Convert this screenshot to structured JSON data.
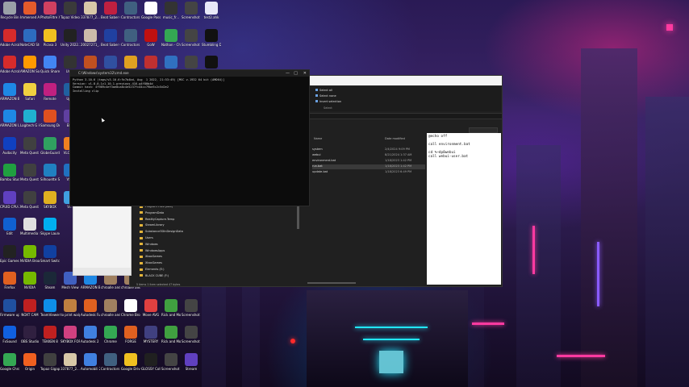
{
  "colors": {
    "accent_blue": "#0a74da",
    "folder": "#e3b43a",
    "console_bg": "#0c0c0c"
  },
  "desktop_icons": [
    {
      "label": "Recycle Bin",
      "color": "#9aa0a8",
      "icon": "recycle-bin-icon",
      "col": 0,
      "row": 0
    },
    {
      "label": "Immersed Agent",
      "color": "#e55a2b",
      "icon": "app-icon",
      "col": 1,
      "row": 0
    },
    {
      "label": "PhotoFiltre X",
      "color": "#d04060",
      "icon": "app-icon",
      "col": 2,
      "row": 0
    },
    {
      "label": "Topaz Video AI",
      "color": "#3a3a3a",
      "icon": "app-icon",
      "col": 3,
      "row": 0
    },
    {
      "label": "337877_2...",
      "color": "#d8c8a8",
      "icon": "file-icon",
      "col": 4,
      "row": 0
    },
    {
      "label": "Beat Saber (SteamVR)",
      "color": "#c02040",
      "icon": "app-icon",
      "col": 5,
      "row": 0
    },
    {
      "label": "Contractors Showdow...",
      "color": "#406080",
      "icon": "app-icon",
      "col": 6,
      "row": 0
    },
    {
      "label": "Google Passes...",
      "color": "#ffffff",
      "icon": "file-icon",
      "col": 7,
      "row": 0
    },
    {
      "label": "music_fr...",
      "color": "#333333",
      "icon": "file-icon",
      "col": 8,
      "row": 0
    },
    {
      "label": "Screenshot 2023-11-2...",
      "color": "#444444",
      "icon": "image-icon",
      "col": 9,
      "row": 0
    },
    {
      "label": "test2.ahk",
      "color": "#e8e8f8",
      "icon": "script-icon",
      "col": 10,
      "row": 0
    },
    {
      "label": "Adobe Acrobat",
      "color": "#d62b2b",
      "icon": "app-icon",
      "col": 0,
      "row": 1
    },
    {
      "label": "NoteCAD Studio 2024",
      "color": "#2d6cc0",
      "icon": "app-icon",
      "col": 1,
      "row": 1
    },
    {
      "label": "Picasa 3",
      "color": "#f0c020",
      "icon": "app-icon",
      "col": 2,
      "row": 1
    },
    {
      "label": "Unity 2022.3.16f1",
      "color": "#222222",
      "icon": "app-icon",
      "col": 3,
      "row": 1
    },
    {
      "label": "20027271_...",
      "color": "#ccbbaa",
      "icon": "file-icon",
      "col": 4,
      "row": 1
    },
    {
      "label": "Beat Saber (VD)",
      "color": "#2040a0",
      "icon": "app-icon",
      "col": 5,
      "row": 1
    },
    {
      "label": "Contractors Showdow...",
      "color": "#406080",
      "icon": "app-icon",
      "col": 6,
      "row": 1
    },
    {
      "label": "GoW",
      "color": "#c01010",
      "icon": "app-icon",
      "col": 7,
      "row": 1
    },
    {
      "label": "Nathan - Chrome",
      "color": "#34a853",
      "icon": "chrome-icon",
      "col": 8,
      "row": 1
    },
    {
      "label": "Screenshot 2023-11-0...",
      "color": "#444444",
      "icon": "image-icon",
      "col": 9,
      "row": 1
    },
    {
      "label": "Stumbling Death - Sam...",
      "color": "#111111",
      "icon": "app-icon",
      "col": 10,
      "row": 1
    },
    {
      "label": "Adobe Acrobat...",
      "color": "#d62b2b",
      "icon": "app-icon",
      "col": 0,
      "row": 2
    },
    {
      "label": "AMAZON Software...",
      "color": "#ff9900",
      "icon": "app-icon",
      "col": 1,
      "row": 2
    },
    {
      "label": "Quick Share from Google",
      "color": "#4285f4",
      "icon": "app-icon",
      "col": 2,
      "row": 2
    },
    {
      "label": "Unity",
      "color": "#333333",
      "icon": "app-icon",
      "col": 3,
      "row": 2
    },
    {
      "label": "",
      "color": "#c05020",
      "icon": "app-icon",
      "col": 4,
      "row": 2
    },
    {
      "label": "",
      "color": "#3050a0",
      "icon": "app-icon",
      "col": 5,
      "row": 2
    },
    {
      "label": "",
      "color": "#e0a020",
      "icon": "app-icon",
      "col": 6,
      "row": 2
    },
    {
      "label": "",
      "color": "#c03030",
      "icon": "app-icon",
      "col": 7,
      "row": 2
    },
    {
      "label": "",
      "color": "#3070c0",
      "icon": "app-icon",
      "col": 8,
      "row": 2
    },
    {
      "label": "",
      "color": "#444444",
      "icon": "image-icon",
      "col": 9,
      "row": 2
    },
    {
      "label": "",
      "color": "#111111",
      "icon": "app-icon",
      "col": 10,
      "row": 2
    },
    {
      "label": "ARMAZON Browser",
      "color": "#1e88e5",
      "icon": "app-icon",
      "col": 0,
      "row": 3
    },
    {
      "label": "Safari",
      "color": "#f0d040",
      "icon": "app-icon",
      "col": 1,
      "row": 3
    },
    {
      "label": "Remote",
      "color": "#c02080",
      "icon": "app-icon",
      "col": 2,
      "row": 3
    },
    {
      "label": "Up...",
      "color": "#2060a0",
      "icon": "app-icon",
      "col": 3,
      "row": 3
    },
    {
      "label": "ARMAZON Updater",
      "color": "#1e88e5",
      "icon": "app-icon",
      "col": 0,
      "row": 4
    },
    {
      "label": "Logitech G HUB",
      "color": "#20b0d0",
      "icon": "app-icon",
      "col": 1,
      "row": 4
    },
    {
      "label": "Samsung DeX",
      "color": "#e05020",
      "icon": "app-icon",
      "col": 2,
      "row": 4
    },
    {
      "label": "Eli...",
      "color": "#6040a0",
      "icon": "app-icon",
      "col": 3,
      "row": 4
    },
    {
      "label": "Audacity",
      "color": "#1040c0",
      "icon": "app-icon",
      "col": 0,
      "row": 5
    },
    {
      "label": "Meta Quest Developer",
      "color": "#404040",
      "icon": "app-icon",
      "col": 1,
      "row": 5
    },
    {
      "label": "GlobeGuard",
      "color": "#30a060",
      "icon": "app-icon",
      "col": 2,
      "row": 5
    },
    {
      "label": "VLC m...",
      "color": "#f08020",
      "icon": "app-icon",
      "col": 3,
      "row": 5
    },
    {
      "label": "Bambu Studio",
      "color": "#20a040",
      "icon": "app-icon",
      "col": 0,
      "row": 6
    },
    {
      "label": "Meta Quest Link",
      "color": "#404040",
      "icon": "app-icon",
      "col": 1,
      "row": 6
    },
    {
      "label": "Silhouette Studio",
      "color": "#2080c0",
      "icon": "app-icon",
      "col": 2,
      "row": 6
    },
    {
      "label": "VS...",
      "color": "#2070c0",
      "icon": "app-icon",
      "col": 3,
      "row": 6
    },
    {
      "label": "CPUID CPU-Z",
      "color": "#6040c0",
      "icon": "app-icon",
      "col": 0,
      "row": 7
    },
    {
      "label": "Meta Quest Remote D...",
      "color": "#404040",
      "icon": "app-icon",
      "col": 1,
      "row": 7
    },
    {
      "label": "SKYBOX",
      "color": "#e0b020",
      "icon": "app-icon",
      "col": 2,
      "row": 7
    },
    {
      "label": "Vi...",
      "color": "#40a0e0",
      "icon": "app-icon",
      "col": 3,
      "row": 7
    },
    {
      "label": "Edit",
      "color": "#1060d0",
      "icon": "app-icon",
      "col": 0,
      "row": 8
    },
    {
      "label": "Multimedia Product Tool",
      "color": "#e0e0e0",
      "icon": "app-icon",
      "col": 1,
      "row": 8
    },
    {
      "label": "Skype Launcher",
      "color": "#00aff0",
      "icon": "app-icon",
      "col": 2,
      "row": 8
    },
    {
      "label": "Epic Games Launcher",
      "color": "#222222",
      "icon": "app-icon",
      "col": 0,
      "row": 9
    },
    {
      "label": "NVIDIA Broadcast",
      "color": "#76b900",
      "icon": "app-icon",
      "col": 1,
      "row": 9
    },
    {
      "label": "Smart Switch",
      "color": "#1040a0",
      "icon": "app-icon",
      "col": 2,
      "row": 9
    },
    {
      "label": "Firefox",
      "color": "#e06020",
      "icon": "app-icon",
      "col": 0,
      "row": 10
    },
    {
      "label": "NVIDIA",
      "color": "#76b900",
      "icon": "app-icon",
      "col": 1,
      "row": 10
    },
    {
      "label": "Steam",
      "color": "#1b2838",
      "icon": "app-icon",
      "col": 2,
      "row": 10
    },
    {
      "label": "Mesh View",
      "color": "#4060c0",
      "icon": "app-icon",
      "col": 3,
      "row": 10
    },
    {
      "label": "ARMAZON Browser",
      "color": "#1e88e5",
      "icon": "app-icon",
      "col": 4,
      "row": 10
    },
    {
      "label": "chroalle and balls.jpg",
      "color": "#a08060",
      "icon": "image-icon",
      "col": 5,
      "row": 10
    },
    {
      "label": "chroalle and balls",
      "color": "#a08060",
      "icon": "image-icon",
      "col": 6,
      "row": 10
    },
    {
      "label": "Firmware update fo...",
      "color": "#2050a0",
      "icon": "app-icon",
      "col": 0,
      "row": 11
    },
    {
      "label": "NOXT CAM",
      "color": "#c02020",
      "icon": "app-icon",
      "col": 1,
      "row": 11
    },
    {
      "label": "TeamViewer",
      "color": "#0e8ee9",
      "icon": "app-icon",
      "col": 2,
      "row": 11
    },
    {
      "label": "to print walgreens",
      "color": "#c08040",
      "icon": "file-icon",
      "col": 3,
      "row": 11
    },
    {
      "label": "Autodesk Fusion 360",
      "color": "#e06020",
      "icon": "app-icon",
      "col": 4,
      "row": 11
    },
    {
      "label": "chroalle and balls-glogg...",
      "color": "#a08060",
      "icon": "image-icon",
      "col": 5,
      "row": 11
    },
    {
      "label": "Chrome Browse MOCKUP",
      "color": "#ffffff",
      "icon": "chrome-icon",
      "col": 6,
      "row": 11
    },
    {
      "label": "Move AVG",
      "color": "#e04040",
      "icon": "app-icon",
      "col": 7,
      "row": 11
    },
    {
      "label": "Rick and Morty",
      "color": "#40a040",
      "icon": "app-icon",
      "col": 8,
      "row": 11
    },
    {
      "label": "Screenshot 2023-11...",
      "color": "#444444",
      "icon": "image-icon",
      "col": 9,
      "row": 11
    },
    {
      "label": "FxSound",
      "color": "#1060e0",
      "icon": "app-icon",
      "col": 0,
      "row": 12
    },
    {
      "label": "OBS Studio",
      "color": "#302040",
      "icon": "app-icon",
      "col": 1,
      "row": 12
    },
    {
      "label": "TEKKEN 8",
      "color": "#c02020",
      "icon": "app-icon",
      "col": 2,
      "row": 12
    },
    {
      "label": "SKYBOX FOR...",
      "color": "#d04080",
      "icon": "app-icon",
      "col": 3,
      "row": 12
    },
    {
      "label": "Autodesk 2 (SteamVR)",
      "color": "#4080e0",
      "icon": "app-icon",
      "col": 4,
      "row": 12
    },
    {
      "label": "Chrome",
      "color": "#34a853",
      "icon": "chrome-icon",
      "col": 5,
      "row": 12
    },
    {
      "label": "FORGE",
      "color": "#e06020",
      "icon": "app-icon",
      "col": 6,
      "row": 12
    },
    {
      "label": "MYSTERY",
      "color": "#404080",
      "icon": "app-icon",
      "col": 7,
      "row": 12
    },
    {
      "label": "Rick and Morty",
      "color": "#40a040",
      "icon": "app-icon",
      "col": 8,
      "row": 12
    },
    {
      "label": "Screenshot 2023-11-0...",
      "color": "#444444",
      "icon": "image-icon",
      "col": 9,
      "row": 12
    },
    {
      "label": "Google Chrome",
      "color": "#34a853",
      "icon": "chrome-icon",
      "col": 0,
      "row": 13
    },
    {
      "label": "Origin",
      "color": "#f06020",
      "icon": "app-icon",
      "col": 1,
      "row": 13
    },
    {
      "label": "Topaz Gigapixel AI",
      "color": "#404040",
      "icon": "app-icon",
      "col": 2,
      "row": 13
    },
    {
      "label": "337877_2...",
      "color": "#d8c8a8",
      "icon": "file-icon",
      "col": 3,
      "row": 13
    },
    {
      "label": "Automobili 2 (VD)",
      "color": "#4080e0",
      "icon": "app-icon",
      "col": 4,
      "row": 13
    },
    {
      "label": "Contractors Showdow...",
      "color": "#406080",
      "icon": "app-icon",
      "col": 5,
      "row": 13
    },
    {
      "label": "Google Drive",
      "color": "#f0c020",
      "icon": "app-icon",
      "col": 6,
      "row": 13
    },
    {
      "label": "GLOSSY Collection...",
      "color": "#202020",
      "icon": "app-icon",
      "col": 7,
      "row": 13
    },
    {
      "label": "Screenshot 2023-11-0...",
      "color": "#444444",
      "icon": "image-icon",
      "col": 8,
      "row": 13
    },
    {
      "label": "Stream",
      "color": "#6040c0",
      "icon": "app-icon",
      "col": 9,
      "row": 13
    }
  ],
  "cmd_window": {
    "title": "C:\\Windows\\system32\\cmd.exe",
    "minimize": "—",
    "maximize": "□",
    "close": "✕",
    "lines": [
      "Python 3.10.6 (tags/v3.10.6:9c7b4bd, Aug  1 2022, 21:53:49) [MSC v.1932 64 bit (AMD64)]",
      "Version: v1.8.0-1v1.10.1-previous-416-g4f80b4d",
      "Commit hash: 4f989c4ef3ae8ca8c4e5237fcd4cc79be5c2c5d2e2",
      "Installing clip"
    ]
  },
  "explorer": {
    "ribbon": [
      "Select all",
      "Select none",
      "Invert selection",
      "Select"
    ],
    "column_headers": {
      "name": "Name",
      "date": "Date modified"
    },
    "files": [
      {
        "name": "",
        "date": ""
      },
      {
        "name": "system",
        "date": "2/4/2024 9:09 PM"
      },
      {
        "name": "webui",
        "date": "8/21/2024 1:37 AM"
      },
      {
        "name": "environment.bat",
        "date": "1/18/2023 1:42 PM"
      },
      {
        "name": "run.bat",
        "date": "1/18/2023 1:42 PM",
        "selected": true
      },
      {
        "name": "update.bat",
        "date": "1/18/2023 6:49 PM"
      }
    ],
    "tree": [
      "Program Files (x86)",
      "ProgramData",
      "RealityCapture.Temp",
      "SteamLibrary",
      "Substance3DInDesignData",
      "Users",
      "Windows",
      "WindowsApps",
      "XboxGames",
      "XboxGames",
      "Elements (E:)",
      "BLACK CUBE (F:)"
    ],
    "status": "5 items   1 item selected  47 bytes"
  },
  "preview": {
    "lines": [
      "@echo off",
      "",
      "call environment.bat",
      "",
      "cd %~dp0webui",
      "call webui-user.bat"
    ]
  }
}
